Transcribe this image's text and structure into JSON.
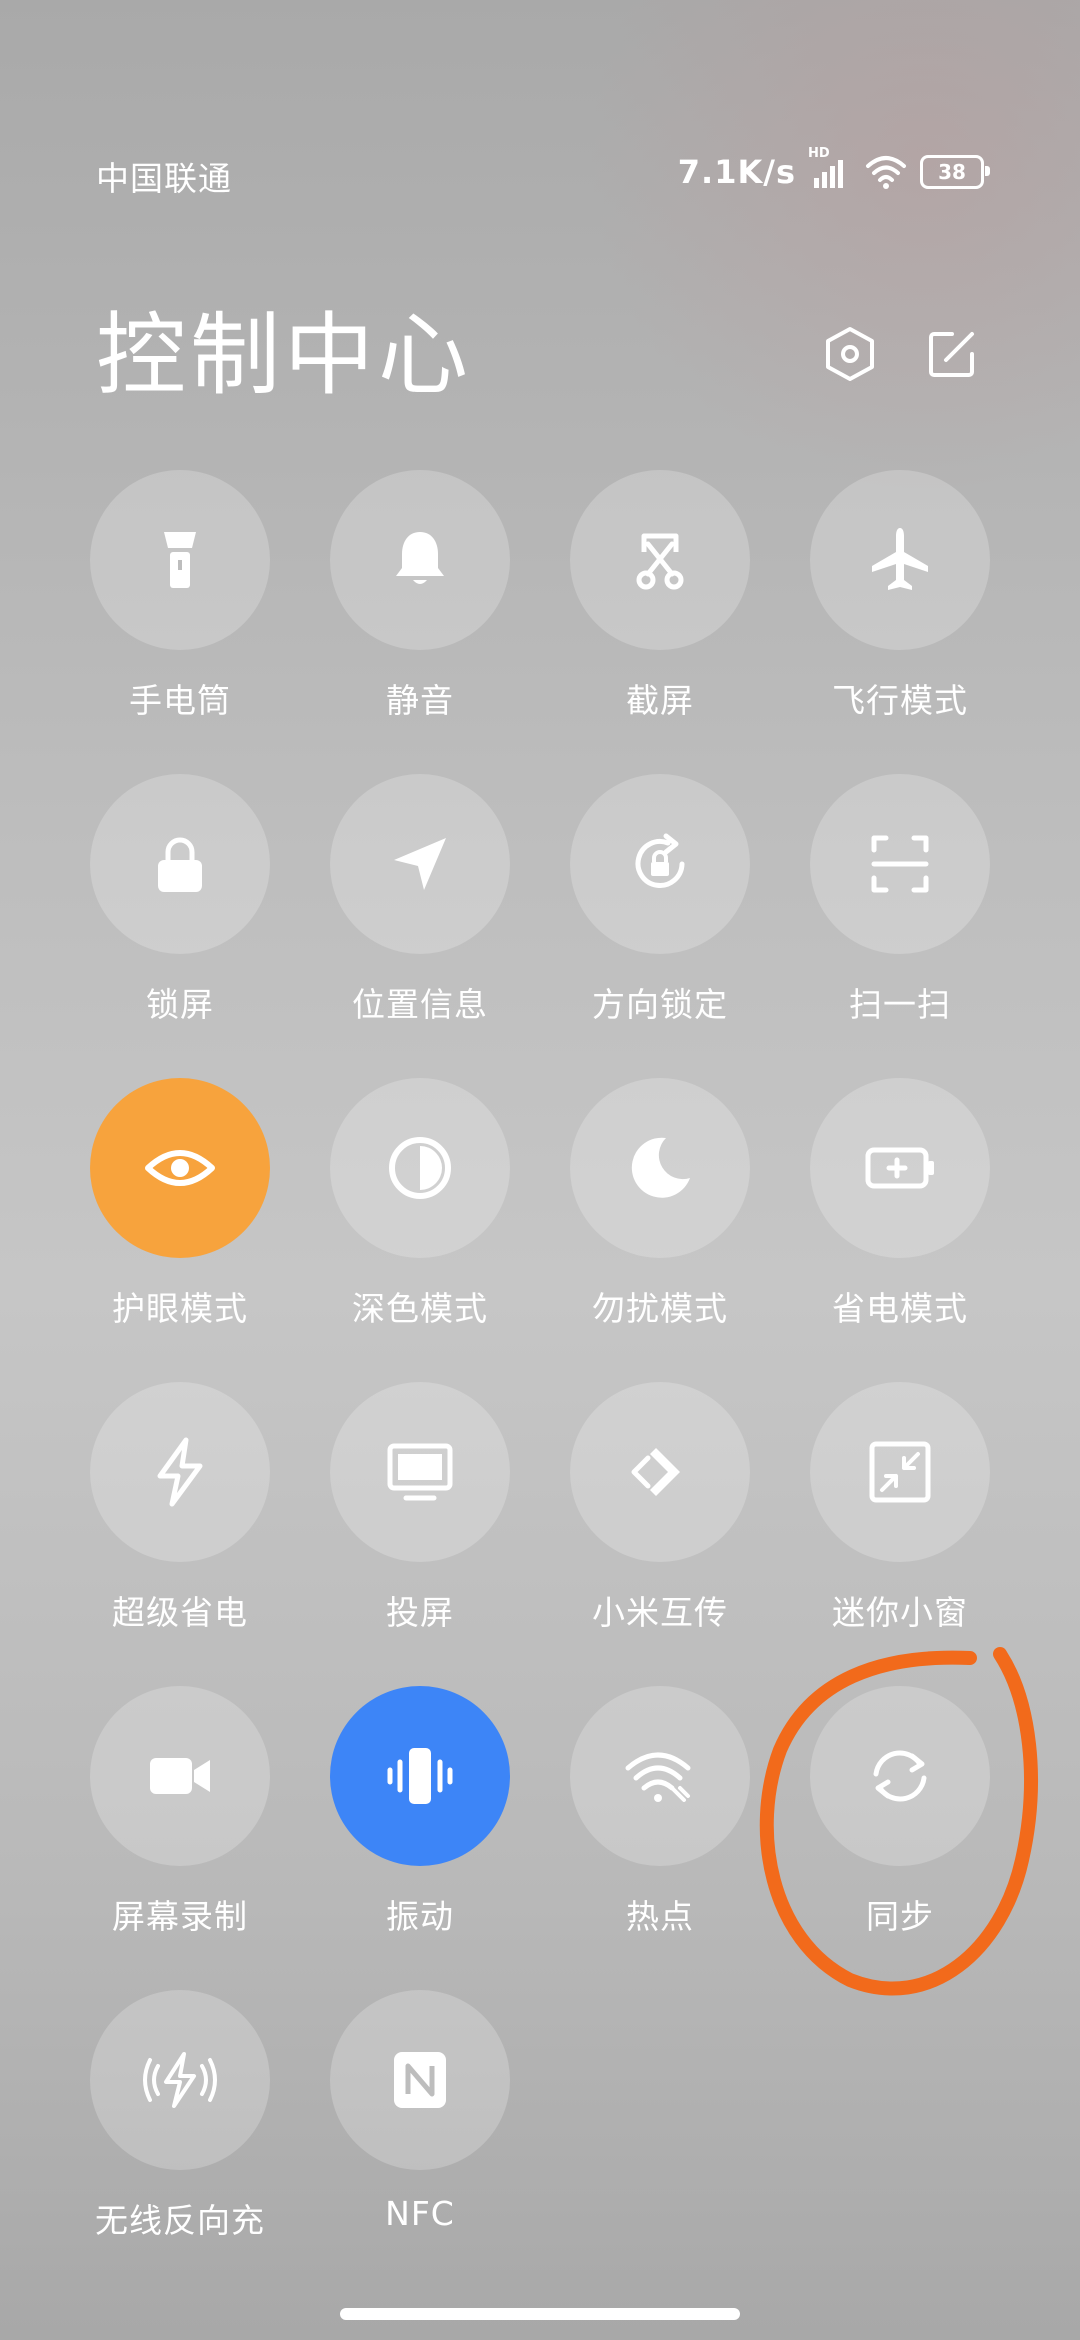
{
  "status": {
    "carrier": "中国联通",
    "speed": "7.1K/s",
    "network_badge": "HD",
    "battery": "38"
  },
  "header": {
    "title": "控制中心"
  },
  "tiles": [
    {
      "label": "手电筒",
      "icon": "flashlight-icon",
      "active": false
    },
    {
      "label": "静音",
      "icon": "bell-icon",
      "active": false
    },
    {
      "label": "截屏",
      "icon": "screenshot-icon",
      "active": false
    },
    {
      "label": "飞行模式",
      "icon": "airplane-icon",
      "active": false
    },
    {
      "label": "锁屏",
      "icon": "lock-icon",
      "active": false
    },
    {
      "label": "位置信息",
      "icon": "location-arrow-icon",
      "active": false
    },
    {
      "label": "方向锁定",
      "icon": "rotation-lock-icon",
      "active": false
    },
    {
      "label": "扫一扫",
      "icon": "scan-icon",
      "active": false
    },
    {
      "label": "护眼模式",
      "icon": "eye-icon",
      "active": true,
      "color": "#f7a33d"
    },
    {
      "label": "深色模式",
      "icon": "dark-mode-icon",
      "active": false
    },
    {
      "label": "勿扰模式",
      "icon": "moon-icon",
      "active": false
    },
    {
      "label": "省电模式",
      "icon": "battery-saver-icon",
      "active": false
    },
    {
      "label": "超级省电",
      "icon": "bolt-icon",
      "active": false
    },
    {
      "label": "投屏",
      "icon": "cast-screen-icon",
      "active": false
    },
    {
      "label": "小米互传",
      "icon": "share-transfer-icon",
      "active": false
    },
    {
      "label": "迷你小窗",
      "icon": "mini-window-icon",
      "active": false
    },
    {
      "label": "屏幕录制",
      "icon": "video-camera-icon",
      "active": false
    },
    {
      "label": "振动",
      "icon": "vibration-icon",
      "active": true,
      "color": "#3d85f7"
    },
    {
      "label": "热点",
      "icon": "hotspot-icon",
      "active": false
    },
    {
      "label": "同步",
      "icon": "sync-icon",
      "active": false
    },
    {
      "label": "无线反向充",
      "icon": "wireless-charge-icon",
      "active": false
    },
    {
      "label": "NFC",
      "icon": "nfc-icon",
      "active": false
    }
  ],
  "colors": {
    "active_orange": "#f7a33d",
    "active_blue": "#3d85f7",
    "annotation": "#f26a1b"
  }
}
